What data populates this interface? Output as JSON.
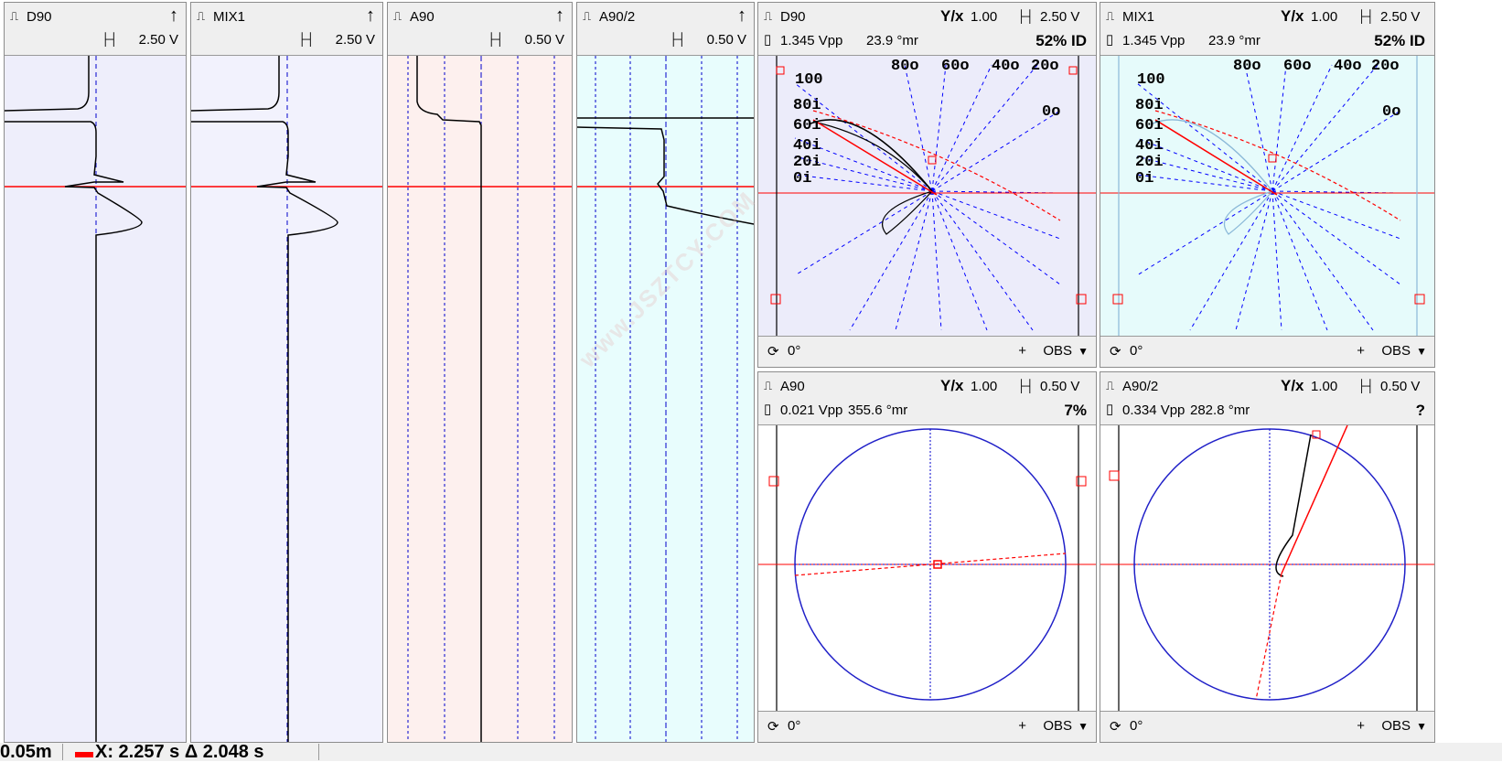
{
  "strips": [
    {
      "name": "D90",
      "scale": "2.50 V",
      "bg": "#eeeefb"
    },
    {
      "name": "MIX1",
      "scale": "2.50 V",
      "bg": "#f2f2fd"
    },
    {
      "name": "A90",
      "scale": "0.50 V",
      "bg": "#fdf0ee"
    },
    {
      "name": "A90/2",
      "scale": "0.50 V",
      "bg": "#e8fdfd"
    }
  ],
  "lissajous": [
    {
      "name": "D90",
      "ratio": "1.00",
      "scale": "2.50 V",
      "vpp": "1.345 Vpp",
      "angle": "23.9 °mr",
      "result": "52% ID",
      "rotation": "0°",
      "obs": "OBS"
    },
    {
      "name": "MIX1",
      "ratio": "1.00",
      "scale": "2.50 V",
      "vpp": "1.345 Vpp",
      "angle": "23.9 °mr",
      "result": "52% ID",
      "rotation": "0°",
      "obs": "OBS"
    },
    {
      "name": "A90",
      "ratio": "1.00",
      "scale": "0.50 V",
      "vpp": "0.021 Vpp",
      "angle": "355.6 °mr",
      "result": "7%",
      "rotation": "0°",
      "obs": "OBS"
    },
    {
      "name": "A90/2",
      "ratio": "1.00",
      "scale": "0.50 V",
      "vpp": "0.334 Vpp",
      "angle": "282.8 °mr",
      "result": "?",
      "rotation": "0°",
      "obs": "OBS"
    }
  ],
  "curve_labels": {
    "od": [
      "100",
      "80o",
      "60o",
      "40o",
      "20o",
      "0o"
    ],
    "id": [
      "80i",
      "60i",
      "40i",
      "20i",
      "0i"
    ]
  },
  "watermark": "www.JSZTCY.COM",
  "status": {
    "left": "0.05m",
    "cursor": "X: 2.257 s  Δ 2.048 s"
  },
  "colors": {
    "trace": "#000000",
    "cursor": "#ff0000",
    "grid": "#0000cc",
    "circle": "#2020c8"
  }
}
